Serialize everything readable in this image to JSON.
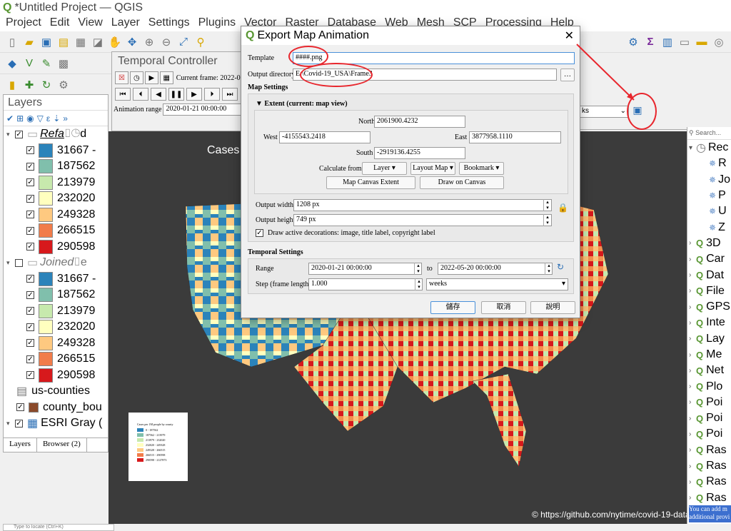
{
  "window": {
    "title": "*Untitled Project — QGIS"
  },
  "menu": [
    "Project",
    "Edit",
    "View",
    "Layer",
    "Settings",
    "Plugins",
    "Vector",
    "Raster",
    "Database",
    "Web",
    "Mesh",
    "SCP",
    "Processing",
    "Help"
  ],
  "temporal": {
    "title": "Temporal Controller",
    "current_frame": "Current frame: 2022-05-17",
    "animation_range_label": "Animation range",
    "animation_range_value": "2020-01-21 00:00:00",
    "step_unit_partial": "ks"
  },
  "layers_panel": {
    "title": "Layers",
    "group1": {
      "name": "Refa",
      "name_suffix": "d"
    },
    "group2": {
      "name": "Joined",
      "name_suffix": "e"
    },
    "classes": [
      "31667 -",
      "187562",
      "213979",
      "232020",
      "249328",
      "266515",
      "290598"
    ],
    "class_colors": [
      "#2b83ba",
      "#80bfac",
      "#c7e9ad",
      "#ffffbf",
      "#fec980",
      "#f17c4a",
      "#d7191c"
    ],
    "us_counties": "us-counties",
    "county_bo": "county_bou",
    "esri": "ESRI Gray (",
    "tabs": [
      "Layers",
      "Browser (2)"
    ]
  },
  "map": {
    "title_partial": "Cases",
    "credit": "© https://github.com/nytime/covid-19-data/"
  },
  "legend": {
    "title": "Cases per 1M people by county",
    "items": [
      "0 - 187562",
      "187562 - 213979",
      "213979 - 232020",
      "232020 - 249328",
      "249328 - 266515",
      "266515 - 290598",
      "290598 - 2127873"
    ]
  },
  "browser_panel": {
    "search_placeholder": "Search...",
    "items": [
      "Rec",
      "R",
      "Jo",
      "P",
      "U",
      "Z",
      "3D",
      "Car",
      "Dat",
      "File",
      "GPS",
      "Inte",
      "Lay",
      "Me",
      "Net",
      "Plo",
      "Poi",
      "Poi",
      "Poi",
      "Ras",
      "Ras",
      "Ras",
      "Ras"
    ],
    "tip": "You can add m additional provi"
  },
  "dialog": {
    "title": "Export Map Animation",
    "template_label": "Template",
    "template_value": "####.png",
    "output_dir_label": "Output directory",
    "output_dir_value": "E:\\Covid-19_USA\\Frame3",
    "browse_btn": "…",
    "map_settings": "Map Settings",
    "extent_title": "Extent (current: map view)",
    "north_label": "North",
    "north_value": "2061900.4232",
    "west_label": "West",
    "west_value": "-4155543.2418",
    "east_label": "East",
    "east_value": "3877958.1110",
    "south_label": "South",
    "south_value": "-2919136.4255",
    "calculate_from": "Calculate from",
    "btn_layer": "Layer",
    "btn_layout_map": "Layout Map",
    "btn_bookmark": "Bookmark",
    "btn_map_canvas_extent": "Map Canvas Extent",
    "btn_draw_on_canvas": "Draw on Canvas",
    "output_width_label": "Output width",
    "output_width_value": "1208 px",
    "output_height_label": "Output height",
    "output_height_value": "749 px",
    "draw_decorations": "Draw active decorations: image, title label, copyright label",
    "temporal_settings": "Temporal Settings",
    "range_label": "Range",
    "range_from": "2020-01-21 00:00:00",
    "range_to_label": "to",
    "range_to": "2022-05-20 00:00:00",
    "step_label": "Step (frame length)",
    "step_value": "1.000",
    "step_unit": "weeks",
    "save_btn": "儲存",
    "cancel_btn": "取消",
    "help_btn": "說明"
  },
  "status": {
    "locate_placeholder": "Type to locate (Ctrl+K)"
  }
}
